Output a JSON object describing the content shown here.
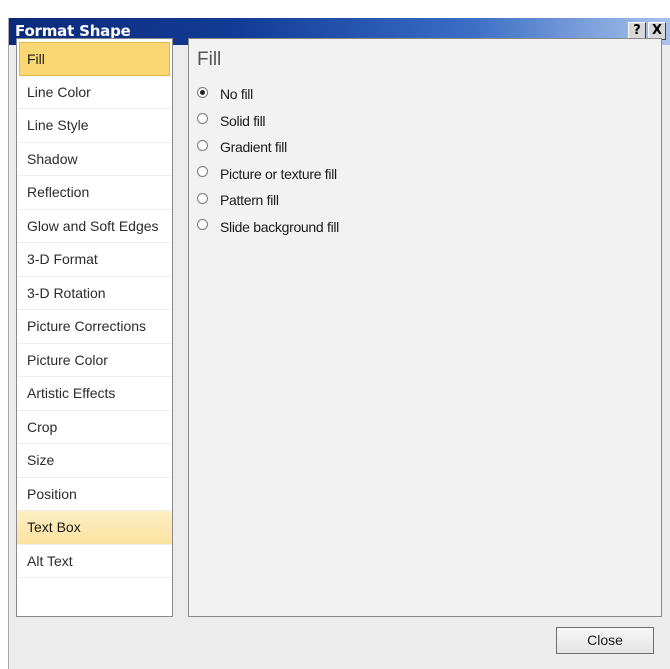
{
  "window": {
    "title": "Format Shape",
    "help_label": "?",
    "close_label": "X"
  },
  "sidebar": {
    "items": [
      {
        "label": "Fill"
      },
      {
        "label": "Line Color"
      },
      {
        "label": "Line Style"
      },
      {
        "label": "Shadow"
      },
      {
        "label": "Reflection"
      },
      {
        "label": "Glow and Soft Edges"
      },
      {
        "label": "3-D Format"
      },
      {
        "label": "3-D Rotation"
      },
      {
        "label": "Picture Corrections"
      },
      {
        "label": "Picture Color"
      },
      {
        "label": "Artistic Effects"
      },
      {
        "label": "Crop"
      },
      {
        "label": "Size"
      },
      {
        "label": "Position"
      },
      {
        "label": "Text Box"
      },
      {
        "label": "Alt Text"
      }
    ],
    "selected": "Fill",
    "hovered": "Text Box"
  },
  "panel": {
    "title": "Fill",
    "options": [
      {
        "label": "No fill",
        "checked": true
      },
      {
        "label": "Solid fill",
        "checked": false
      },
      {
        "label": "Gradient fill",
        "checked": false
      },
      {
        "label": "Picture or texture fill",
        "checked": false
      },
      {
        "label": "Pattern fill",
        "checked": false
      },
      {
        "label": "Slide background fill",
        "checked": false
      }
    ]
  },
  "footer": {
    "close_label": "Close"
  },
  "colors": {
    "selected_bg": "#fbd774",
    "hover_bg": "#fbe2a0",
    "title_bar_start": "#0b2a7a",
    "title_bar_end": "#a9c3ec"
  }
}
